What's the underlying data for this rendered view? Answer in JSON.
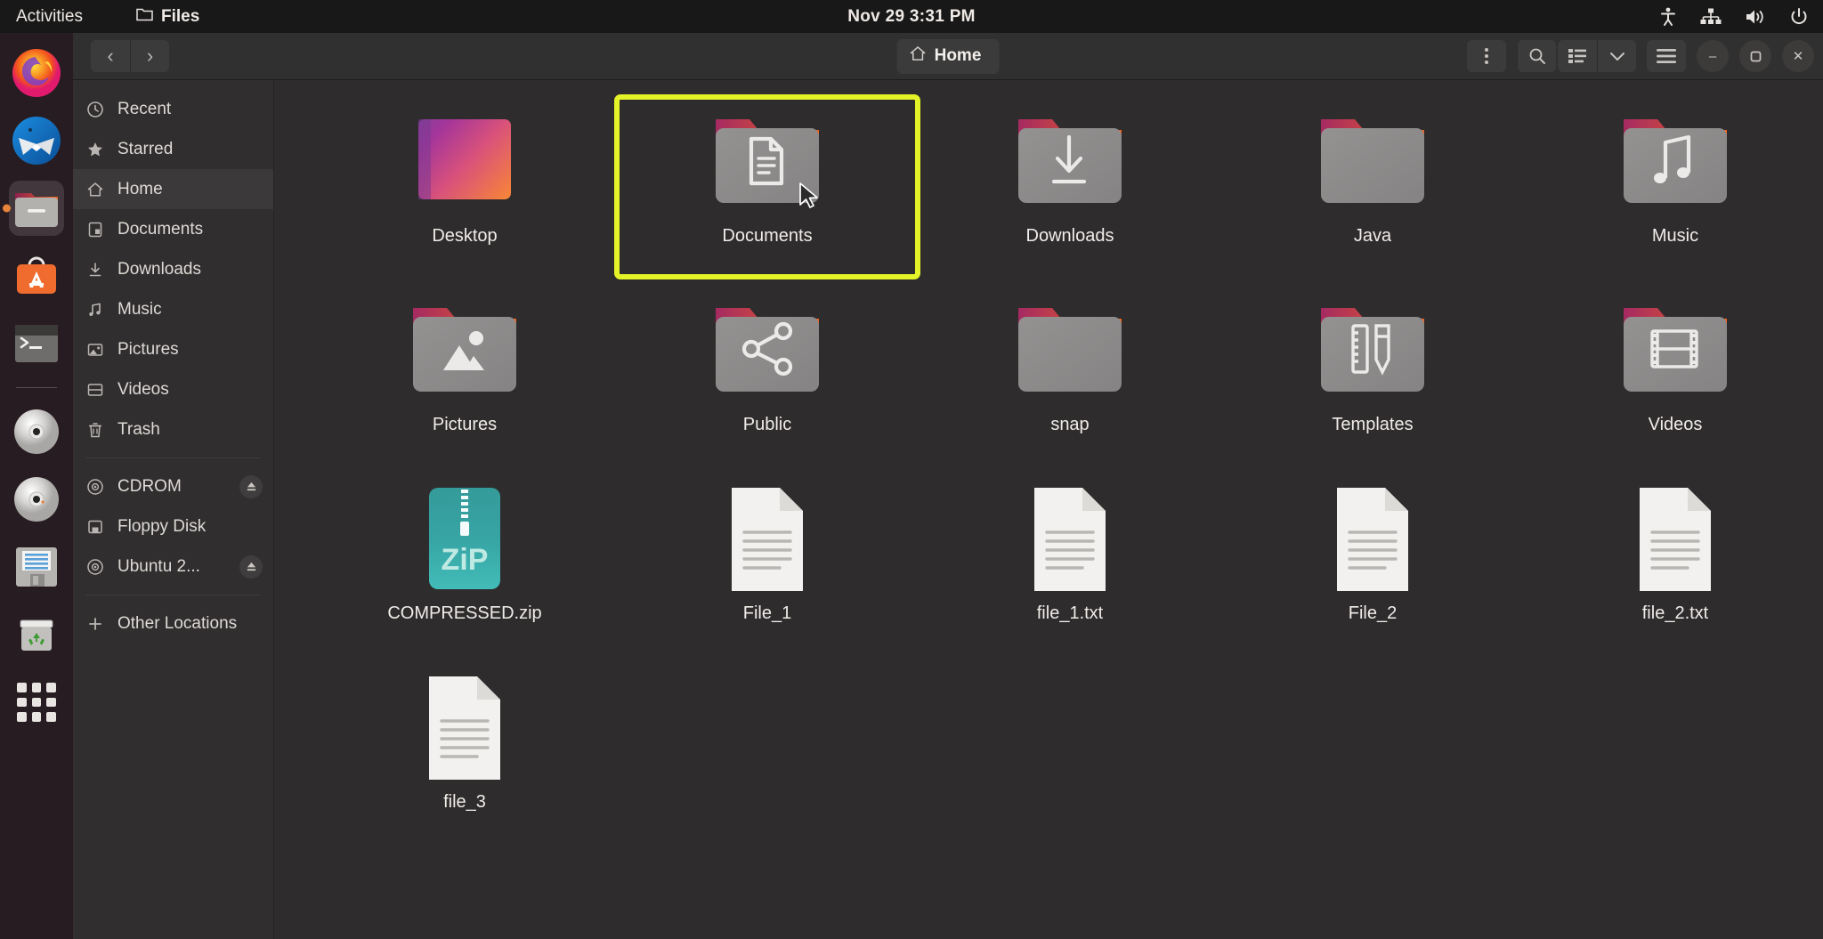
{
  "topbar": {
    "activities": "Activities",
    "app_icon": "files-window-icon",
    "app_name": "Files",
    "clock": "Nov 29  3:31 PM",
    "indicators": [
      {
        "name": "accessibility-icon"
      },
      {
        "name": "network-icon"
      },
      {
        "name": "volume-icon"
      },
      {
        "name": "power-icon"
      }
    ]
  },
  "dock": {
    "items": [
      {
        "name": "firefox-icon",
        "label": "Firefox",
        "active": false
      },
      {
        "name": "thunderbird-icon",
        "label": "Thunderbird",
        "active": false
      },
      {
        "name": "files-icon",
        "label": "Files",
        "active": true
      },
      {
        "name": "ubuntu-software-icon",
        "label": "Ubuntu Software",
        "active": false
      },
      {
        "name": "terminal-icon",
        "label": "Terminal",
        "active": false
      },
      {
        "name": "cdrom-disc-icon",
        "label": "CDROM",
        "active": false
      },
      {
        "name": "ubuntu-disc-icon",
        "label": "Ubuntu 2...",
        "active": false
      },
      {
        "name": "floppy-disk-icon",
        "label": "Floppy Disk",
        "active": false
      },
      {
        "name": "trash-icon",
        "label": "Trash",
        "active": false
      },
      {
        "name": "show-applications-icon",
        "label": "Show Applications",
        "active": false
      }
    ]
  },
  "window": {
    "headerbar": {
      "back_label": "‹",
      "forward_label": "›",
      "path": {
        "icon": "home-icon",
        "label": "Home"
      },
      "menu_icon": "vertical-dots-icon",
      "search_icon": "search-icon",
      "view_list_icon": "list-view-icon",
      "view_chevron_icon": "chevron-down-icon",
      "hamburger_icon": "hamburger-menu-icon",
      "minimize_label": "–",
      "maximize_label": "▢",
      "close_label": "✕"
    }
  },
  "sidebar": {
    "items": [
      {
        "label": "Recent",
        "icon": "clock-icon",
        "selected": false,
        "eject": false
      },
      {
        "label": "Starred",
        "icon": "star-icon",
        "selected": false,
        "eject": false
      },
      {
        "label": "Home",
        "icon": "home-icon",
        "selected": true,
        "eject": false
      },
      {
        "label": "Documents",
        "icon": "document-icon",
        "selected": false,
        "eject": false
      },
      {
        "label": "Downloads",
        "icon": "download-icon",
        "selected": false,
        "eject": false
      },
      {
        "label": "Music",
        "icon": "music-icon",
        "selected": false,
        "eject": false
      },
      {
        "label": "Pictures",
        "icon": "picture-icon",
        "selected": false,
        "eject": false
      },
      {
        "label": "Videos",
        "icon": "video-icon",
        "selected": false,
        "eject": false
      },
      {
        "label": "Trash",
        "icon": "trash-icon",
        "selected": false,
        "eject": false
      },
      {
        "separator": true
      },
      {
        "label": "CDROM",
        "icon": "disc-icon",
        "selected": false,
        "eject": true
      },
      {
        "label": "Floppy Disk",
        "icon": "floppy-icon",
        "selected": false,
        "eject": false
      },
      {
        "label": "Ubuntu 2...",
        "icon": "disc-icon",
        "selected": false,
        "eject": true
      },
      {
        "separator": true
      },
      {
        "label": "Other Locations",
        "icon": "plus-icon",
        "selected": false,
        "eject": false
      }
    ]
  },
  "files": [
    {
      "label": "Desktop",
      "type": "wallpaper",
      "glyph": "gradient-thumbnail",
      "selected": false
    },
    {
      "label": "Documents",
      "type": "folder",
      "glyph": "document-glyph",
      "selected": true
    },
    {
      "label": "Downloads",
      "type": "folder",
      "glyph": "download-glyph",
      "selected": false
    },
    {
      "label": "Java",
      "type": "folder",
      "glyph": "none",
      "selected": false
    },
    {
      "label": "Music",
      "type": "folder",
      "glyph": "music-glyph",
      "selected": false
    },
    {
      "label": "Pictures",
      "type": "folder",
      "glyph": "picture-glyph",
      "selected": false
    },
    {
      "label": "Public",
      "type": "folder",
      "glyph": "share-glyph",
      "selected": false
    },
    {
      "label": "snap",
      "type": "folder",
      "glyph": "none",
      "selected": false
    },
    {
      "label": "Templates",
      "type": "folder",
      "glyph": "template-glyph",
      "selected": false
    },
    {
      "label": "Videos",
      "type": "folder",
      "glyph": "film-glyph",
      "selected": false
    },
    {
      "label": "COMPRESSED.zip",
      "type": "zip",
      "glyph": "zip-glyph",
      "selected": false
    },
    {
      "label": "File_1",
      "type": "textfile",
      "glyph": "lines-glyph",
      "selected": false
    },
    {
      "label": "file_1.txt",
      "type": "textfile",
      "glyph": "lines-glyph",
      "selected": false
    },
    {
      "label": "File_2",
      "type": "textfile",
      "glyph": "lines-glyph",
      "selected": false
    },
    {
      "label": "file_2.txt",
      "type": "textfile",
      "glyph": "lines-glyph",
      "selected": false
    },
    {
      "label": "file_3",
      "type": "textfile",
      "glyph": "lines-glyph",
      "selected": false
    }
  ],
  "colors": {
    "selection_highlight": "#e4f228",
    "folder_body": "#8d8d8d",
    "folder_tab_start": "#a52a62",
    "folder_tab_end": "#f1641e",
    "zip_teal": "#3aaeae",
    "dock_bg": "#271c21",
    "window_bg": "#2e2c2c",
    "accent_orange": "#e8833a"
  },
  "zip_text": "ZiP"
}
